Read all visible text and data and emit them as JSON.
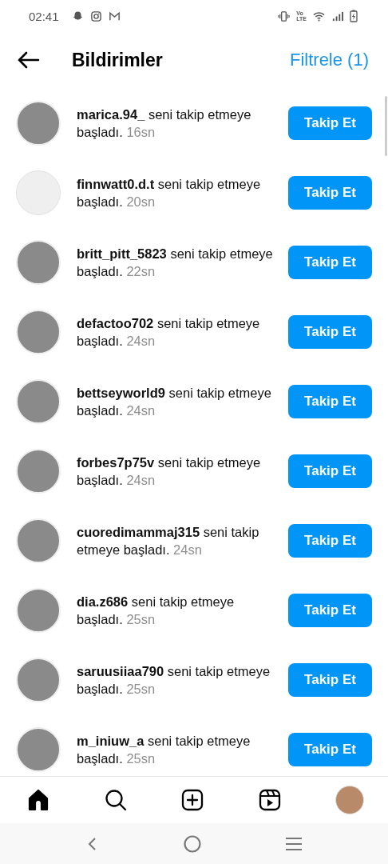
{
  "status_bar": {
    "time": "02:41",
    "network_label": [
      "Vo",
      "LTE"
    ]
  },
  "header": {
    "title": "Bildirimler",
    "filter": "Filtrele (1)"
  },
  "notifications": [
    {
      "kind": "photo",
      "user": "marica.94_",
      "message": "seni takip etmeye başladı.",
      "time": "16sn",
      "button": "Takip Et"
    },
    {
      "kind": "empty",
      "user": "finnwatt0.d.t",
      "message": "seni takip etmeye başladı.",
      "time": "20sn",
      "button": "Takip Et"
    },
    {
      "kind": "photo",
      "user": "britt_pitt_5823",
      "message": "seni takip etmeye başladı.",
      "time": "22sn",
      "button": "Takip Et"
    },
    {
      "kind": "photo",
      "user": "defactoo702",
      "message": "seni takip etmeye başladı.",
      "time": "24sn",
      "button": "Takip Et"
    },
    {
      "kind": "photo",
      "user": "bettseyworld9",
      "message": "seni takip etmeye başladı.",
      "time": "24sn",
      "button": "Takip Et"
    },
    {
      "kind": "photo",
      "user": "forbes7p75v",
      "message": "seni takip etmeye başladı.",
      "time": "24sn",
      "button": "Takip Et"
    },
    {
      "kind": "photo",
      "user": "cuoredimammaj315",
      "message": "seni takip etmeye başladı.",
      "time": "24sn",
      "button": "Takip Et"
    },
    {
      "kind": "photo",
      "user": "dia.z686",
      "message": "seni takip etmeye başladı.",
      "time": "25sn",
      "button": "Takip Et"
    },
    {
      "kind": "photo",
      "user": "saruusiiaa790",
      "message": "seni takip etmeye başladı.",
      "time": "25sn",
      "button": "Takip Et"
    },
    {
      "kind": "photo",
      "user": "m_iniuw_a",
      "message": "seni takip etmeye başladı.",
      "time": "25sn",
      "button": "Takip Et"
    }
  ],
  "bottom_nav": [
    {
      "kind": "home",
      "selected": true
    },
    {
      "kind": "search",
      "selected": false
    },
    {
      "kind": "create",
      "selected": false
    },
    {
      "kind": "reels",
      "selected": false
    },
    {
      "kind": "profile",
      "selected": false
    }
  ]
}
